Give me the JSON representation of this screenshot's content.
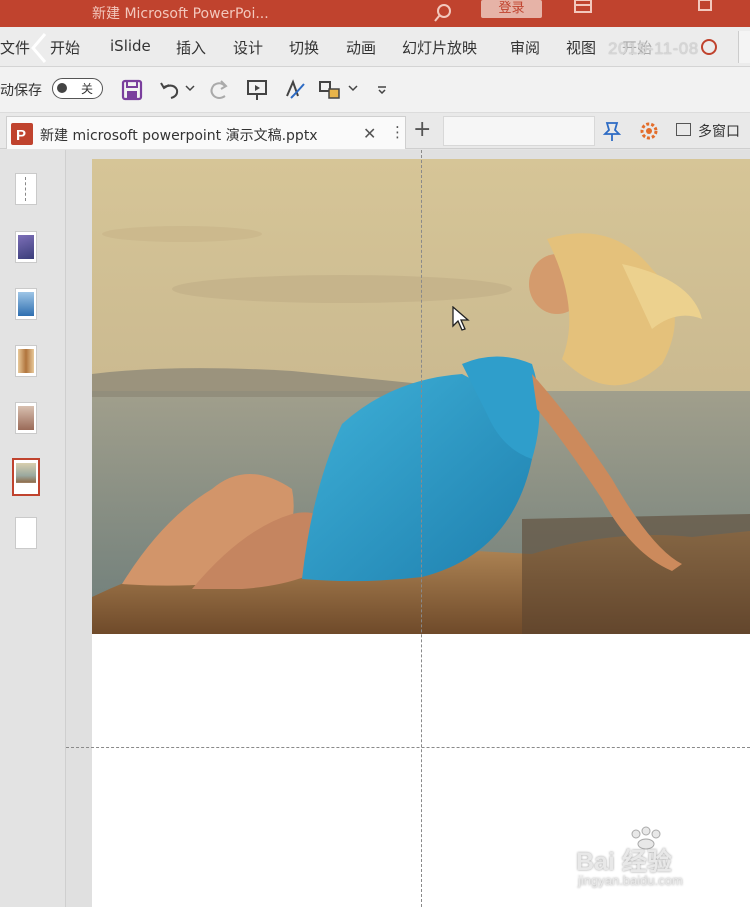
{
  "window": {
    "title": "新建 Microsoft PowerPoi...",
    "login_label": "登录"
  },
  "ribbon": {
    "tabs": [
      "文件",
      "开始",
      "iSlide",
      "插入",
      "设计",
      "切换",
      "动画",
      "幻灯片放映",
      "审阅",
      "视图",
      "开始"
    ],
    "date_stamp": "2019-11-08"
  },
  "quick_access": {
    "autosave_label": "动保存",
    "autosave_state": "关"
  },
  "document": {
    "tab_name": "新建 microsoft powerpoint 演示文稿.pptx",
    "close_glyph": "✕",
    "more_glyph": "⋮",
    "new_tab_glyph": "+",
    "multi_window_label": "多窗口"
  },
  "thumbnails": {
    "count": 7,
    "selected_index": 6
  },
  "watermark": {
    "brand": "Bai 经验",
    "url": "jingyan.baidu.com"
  },
  "colors": {
    "accent": "#c0432e",
    "ribbon_bg": "#ececec",
    "save_icon": "#7a3e9d",
    "gear_icon": "#e36d2b"
  }
}
